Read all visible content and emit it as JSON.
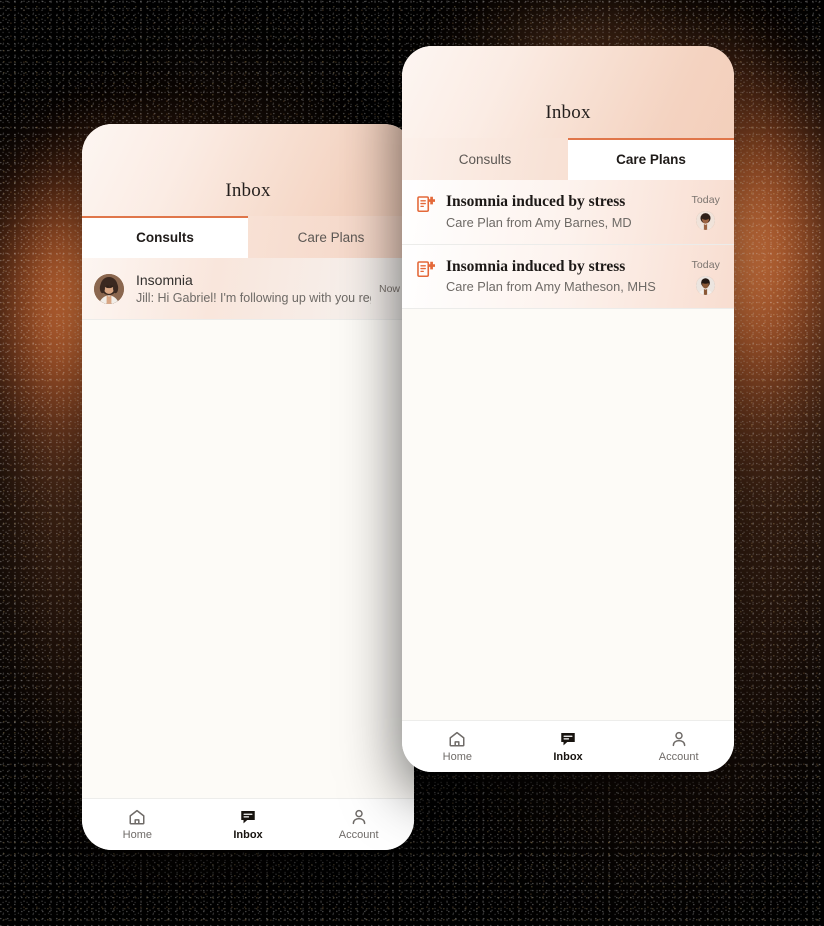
{
  "scene": {
    "background_color": "#000000",
    "glow_color": "#ec7638",
    "accent_color": "#e0764a"
  },
  "phone_back": {
    "header": {
      "title": "Inbox"
    },
    "tabs": [
      {
        "label": "Consults",
        "active": true
      },
      {
        "label": "Care Plans",
        "active": false
      }
    ],
    "list": [
      {
        "title": "Insomnia",
        "subtitle": "Jill: Hi Gabriel! I'm following up with you regardi...",
        "time": "Now",
        "avatar": "woman-avatar"
      }
    ],
    "bottom_nav": [
      {
        "label": "Home",
        "icon": "home-icon",
        "active": false
      },
      {
        "label": "Inbox",
        "icon": "chat-bubble-icon",
        "active": true
      },
      {
        "label": "Account",
        "icon": "person-icon",
        "active": false
      }
    ]
  },
  "phone_front": {
    "header": {
      "title": "Inbox"
    },
    "tabs": [
      {
        "label": "Consults",
        "active": false
      },
      {
        "label": "Care Plans",
        "active": true
      }
    ],
    "list": [
      {
        "title": "Insomnia induced by stress",
        "subtitle": "Care Plan from Amy Barnes, MD",
        "time": "Today",
        "icon": "care-plan-document-icon",
        "avatar": "clinician-avatar-1"
      },
      {
        "title": "Insomnia induced by stress",
        "subtitle": "Care Plan from Amy Matheson, MHS",
        "time": "Today",
        "icon": "care-plan-document-icon",
        "avatar": "clinician-avatar-2"
      }
    ],
    "bottom_nav": [
      {
        "label": "Home",
        "icon": "home-icon",
        "active": false
      },
      {
        "label": "Inbox",
        "icon": "chat-bubble-icon",
        "active": true
      },
      {
        "label": "Account",
        "icon": "person-icon",
        "active": false
      }
    ]
  }
}
